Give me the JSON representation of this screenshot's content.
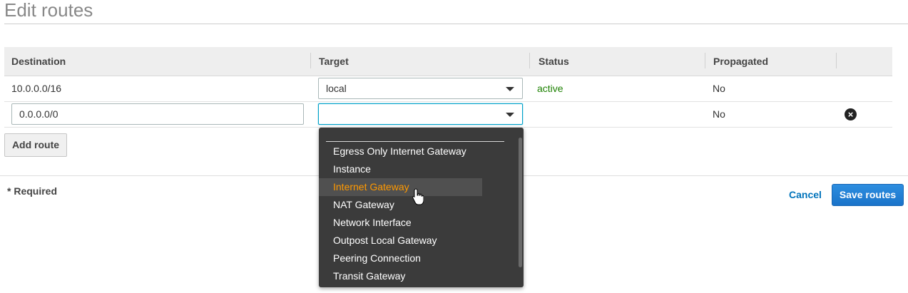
{
  "page": {
    "title": "Edit routes"
  },
  "table": {
    "columns": [
      "Destination",
      "Target",
      "Status",
      "Propagated"
    ],
    "rows": [
      {
        "destination": "10.0.0.0/16",
        "target": "local",
        "status": "active",
        "propagated": "No"
      },
      {
        "destination": "0.0.0.0/0",
        "target": "",
        "status": "",
        "propagated": "No"
      }
    ]
  },
  "buttons": {
    "add_route": "Add route",
    "cancel": "Cancel",
    "save": "Save routes"
  },
  "footer": {
    "required_label": "* Required"
  },
  "dropdown": {
    "items": [
      "Egress Only Internet Gateway",
      "Instance",
      "Internet Gateway",
      "NAT Gateway",
      "Network Interface",
      "Outpost Local Gateway",
      "Peering Connection",
      "Transit Gateway"
    ],
    "highlighted": "Internet Gateway"
  },
  "colors": {
    "status_active": "#1d8102",
    "highlight_text": "#ff9900",
    "primary_button": "#1a73c9",
    "link": "#0073bb"
  },
  "icons": {
    "remove": "remove-circle-icon",
    "cursor": "hand-pointer-icon",
    "caret": "caret-down-icon"
  }
}
